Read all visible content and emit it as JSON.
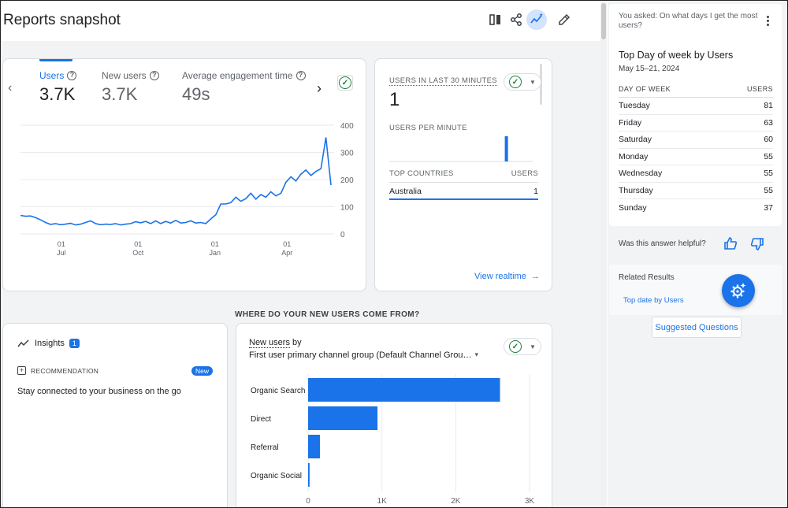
{
  "page": {
    "title": "Reports snapshot"
  },
  "toolbar": {
    "icons": [
      "compare-icon",
      "share-icon",
      "insights-trend-icon",
      "edit-icon"
    ]
  },
  "metrics": {
    "tabs": [
      {
        "label": "Users",
        "value": "3.7K",
        "selected": true
      },
      {
        "label": "New users",
        "value": "3.7K",
        "selected": false
      },
      {
        "label": "Average engagement time",
        "value": "49s",
        "selected": false
      }
    ],
    "question_glyph": "?",
    "check_glyph": "✓"
  },
  "chart_data": {
    "type": "line",
    "series": [
      {
        "values": [
          68,
          65,
          66,
          60,
          52,
          42,
          35,
          38,
          34,
          36,
          39,
          33,
          36,
          42,
          48,
          38,
          34,
          36,
          35,
          38,
          33,
          36,
          38,
          45,
          41,
          46,
          38,
          48,
          38,
          46,
          40,
          50,
          40,
          42,
          48,
          40,
          42,
          38,
          55,
          70,
          110,
          110,
          115,
          135,
          120,
          130,
          150,
          128,
          145,
          135,
          155,
          140,
          150,
          190,
          210,
          195,
          220,
          235,
          215,
          230,
          240,
          355,
          180
        ]
      }
    ],
    "x_tick_labels": [
      [
        "01",
        "Jul"
      ],
      [
        "01",
        "Oct"
      ],
      [
        "01",
        "Jan"
      ],
      [
        "01",
        "Apr"
      ]
    ],
    "y_tick_labels": [
      "400",
      "300",
      "200",
      "100",
      "0"
    ],
    "ylim": [
      0,
      400
    ],
    "grid": true,
    "line_color": "#1a73e8"
  },
  "realtime": {
    "title": "USERS IN LAST 30 MINUTES",
    "value": "1",
    "per_minute_label": "USERS PER MINUTE",
    "per_minute_values": [
      0,
      0,
      0,
      0,
      0,
      0,
      0,
      0,
      0,
      0,
      0,
      0,
      0,
      0,
      0,
      0,
      0,
      0,
      0,
      0,
      0,
      0,
      0,
      0,
      1,
      0,
      0,
      0,
      0,
      0
    ],
    "countries_header": "TOP COUNTRIES",
    "users_header": "USERS",
    "rows": [
      {
        "country": "Australia",
        "users": "1"
      }
    ],
    "link": "View realtime",
    "arrow": "→"
  },
  "section": {
    "heading": "WHERE DO YOUR NEW USERS COME FROM?"
  },
  "insights": {
    "title": "Insights",
    "badge": "1",
    "recommendation_label": "RECOMMENDATION",
    "new_badge": "New",
    "text": "Stay connected to your business on the go"
  },
  "acquisition": {
    "metric_link": "New users",
    "by": " by",
    "dimension": "First user primary channel group (Default Channel Grou…",
    "caret": "▾",
    "chart_data": {
      "type": "bar",
      "orientation": "horizontal",
      "categories": [
        "Organic Search",
        "Direct",
        "Referral",
        "Organic Social"
      ],
      "values": [
        2600,
        940,
        160,
        20
      ],
      "x_tick_labels": [
        "0",
        "1K",
        "2K",
        "3K"
      ],
      "xlim": [
        0,
        3000
      ],
      "bar_color": "#1a73e8"
    }
  },
  "assistant": {
    "question": "You asked: On what days I get the most users?",
    "title": "Top Day of week by Users",
    "date_range": "May 15–21, 2024",
    "col_day": "DAY OF WEEK",
    "col_users": "USERS",
    "rows": [
      {
        "day": "Tuesday",
        "users": "81"
      },
      {
        "day": "Friday",
        "users": "63"
      },
      {
        "day": "Saturday",
        "users": "60"
      },
      {
        "day": "Monday",
        "users": "55"
      },
      {
        "day": "Wednesday",
        "users": "55"
      },
      {
        "day": "Thursday",
        "users": "55"
      },
      {
        "day": "Sunday",
        "users": "37"
      }
    ],
    "helpful_q": "Was this answer helpful?",
    "related_title": "Related Results",
    "related_link": "Top date by Users",
    "suggested_button": "Suggested Questions"
  }
}
